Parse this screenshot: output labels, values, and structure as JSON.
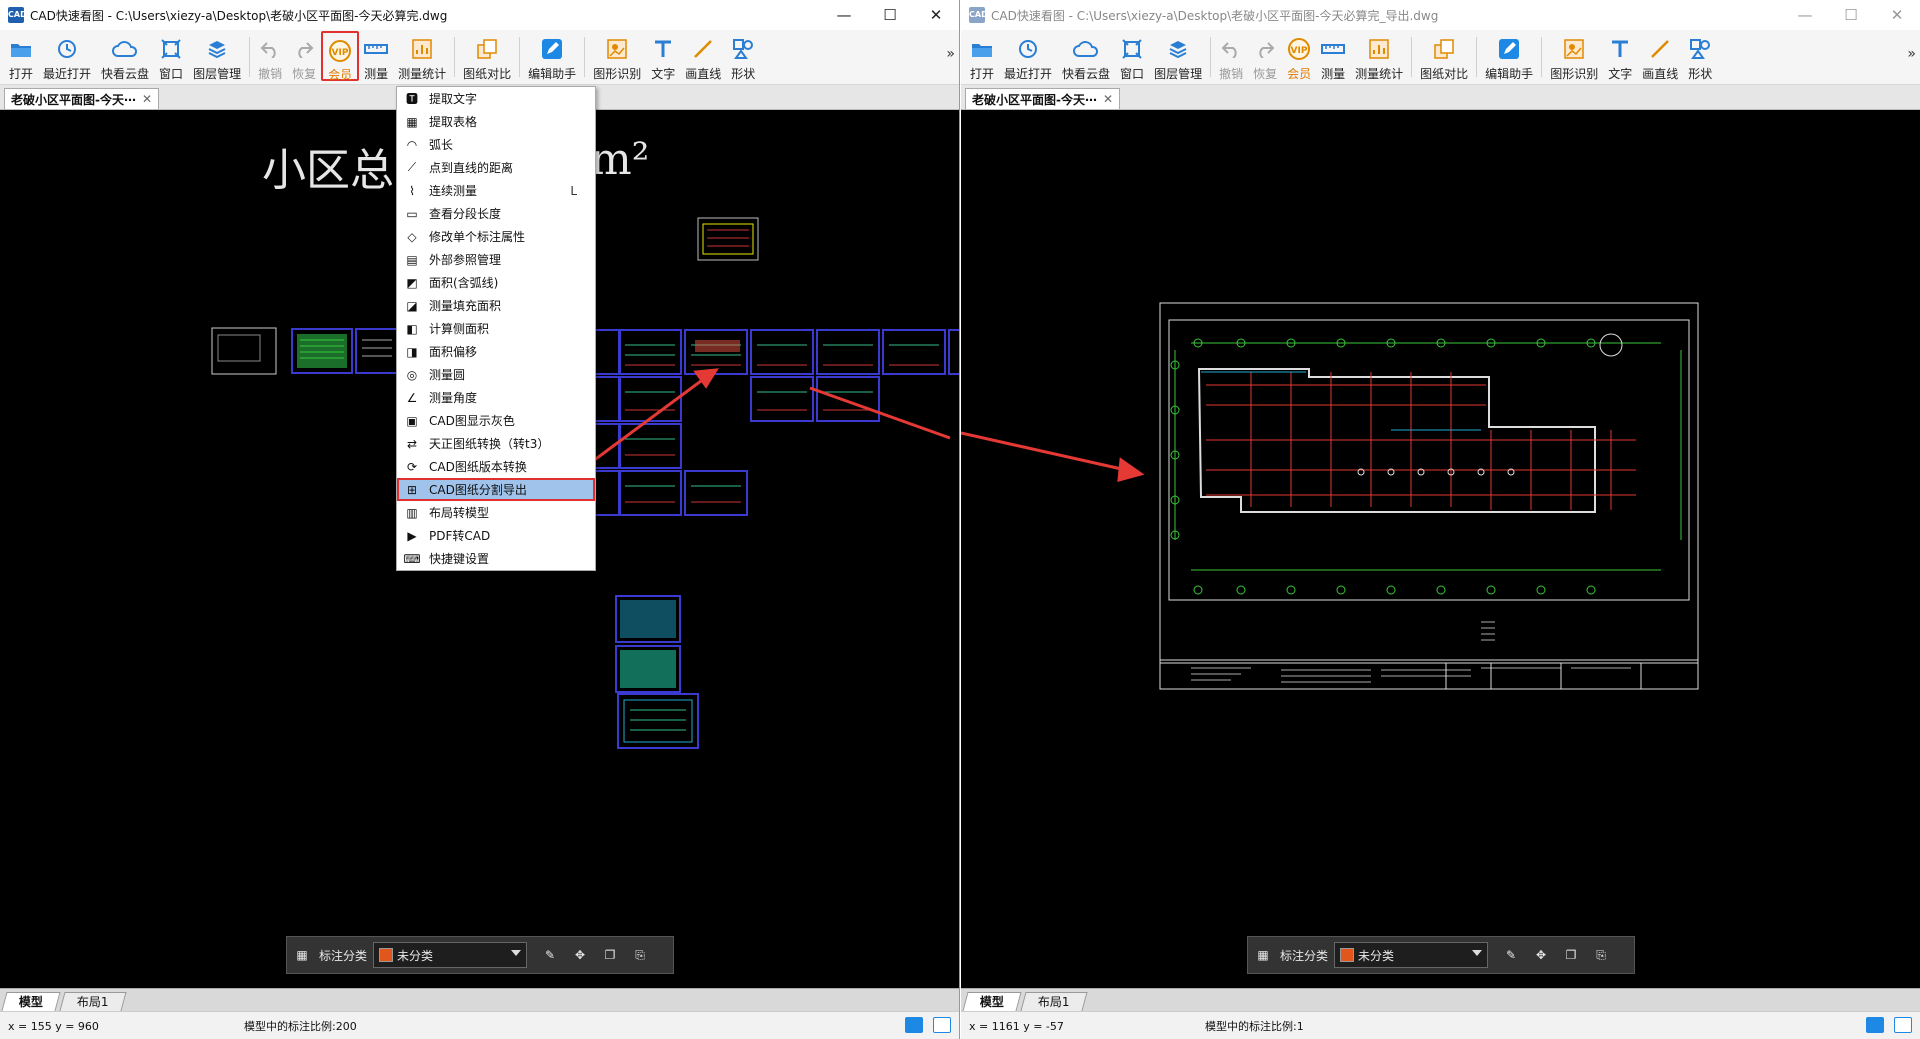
{
  "left": {
    "window_title": "CAD快速看图 - C:\\Users\\xiezy-a\\Desktop\\老破小区平面图-今天必算完.dwg",
    "doc_tab": "老破小区平面图-今天⋯",
    "drawing_title_left": "小区总面",
    "drawing_title_right": "m²",
    "coords": "x = 155  y = 960",
    "scale": "模型中的标注比例:200"
  },
  "right": {
    "window_title": "CAD快速看图 - C:\\Users\\xiezy-a\\Desktop\\老破小区平面图-今天必算完_导出.dwg",
    "doc_tab": "老破小区平面图-今天⋯",
    "coords": "x = 1161  y = -57",
    "scale": "模型中的标注比例:1"
  },
  "app_logo": "CAD",
  "window_controls": {
    "minimize": "—",
    "maximize": "☐",
    "close": "✕"
  },
  "toolbar": {
    "open": "打开",
    "recent": "最近打开",
    "cloud": "快看云盘",
    "window": "窗口",
    "layers": "图层管理",
    "undo": "撤销",
    "redo": "恢复",
    "vip": "会员",
    "measure": "测量",
    "measure_stats": "测量统计",
    "compare": "图纸对比",
    "edit_helper": "编辑助手",
    "shape_recog": "图形识别",
    "text": "文字",
    "line": "画直线",
    "shape": "形状",
    "more": "»"
  },
  "icons": {
    "open": "folder-icon",
    "recent": "clock-icon",
    "cloud": "cloud-icon",
    "window": "window-icon",
    "layers": "layers-icon",
    "undo": "undo-icon",
    "redo": "redo-icon",
    "vip": "vip-icon",
    "measure": "ruler-icon",
    "measure_stats": "chart-icon",
    "compare": "compare-icon",
    "edit_helper": "edit-icon",
    "shape_recog": "recognize-icon",
    "text": "text-icon",
    "line": "line-icon",
    "shape": "shape-icon"
  },
  "vip_menu": [
    {
      "label": "提取文字",
      "key": ""
    },
    {
      "label": "提取表格",
      "key": ""
    },
    {
      "label": "弧长",
      "key": ""
    },
    {
      "label": "点到直线的距离",
      "key": ""
    },
    {
      "label": "连续测量",
      "key": "L"
    },
    {
      "label": "查看分段长度",
      "key": ""
    },
    {
      "label": "修改单个标注属性",
      "key": ""
    },
    {
      "label": "外部参照管理",
      "key": ""
    },
    {
      "label": "面积(含弧线)",
      "key": ""
    },
    {
      "label": "测量填充面积",
      "key": ""
    },
    {
      "label": "计算侧面积",
      "key": ""
    },
    {
      "label": "面积偏移",
      "key": ""
    },
    {
      "label": "测量圆",
      "key": ""
    },
    {
      "label": "测量角度",
      "key": ""
    },
    {
      "label": "CAD图显示灰色",
      "key": ""
    },
    {
      "label": "天正图纸转换（转t3）",
      "key": ""
    },
    {
      "label": "CAD图纸版本转换",
      "key": ""
    },
    {
      "label": "CAD图纸分割导出",
      "key": ""
    },
    {
      "label": "布局转模型",
      "key": ""
    },
    {
      "label": "PDF转CAD",
      "key": ""
    },
    {
      "label": "快捷键设置",
      "key": ""
    }
  ],
  "annotation_bar": {
    "label": "标注分类",
    "selected": "未分类",
    "swatch_color": "#e0561b"
  },
  "layout_tabs": {
    "model": "模型",
    "layout1": "布局1"
  },
  "colors": {
    "highlight_red": "#e03030",
    "menu_highlight": "#9fc3ea",
    "canvas_bg": "#000000"
  }
}
